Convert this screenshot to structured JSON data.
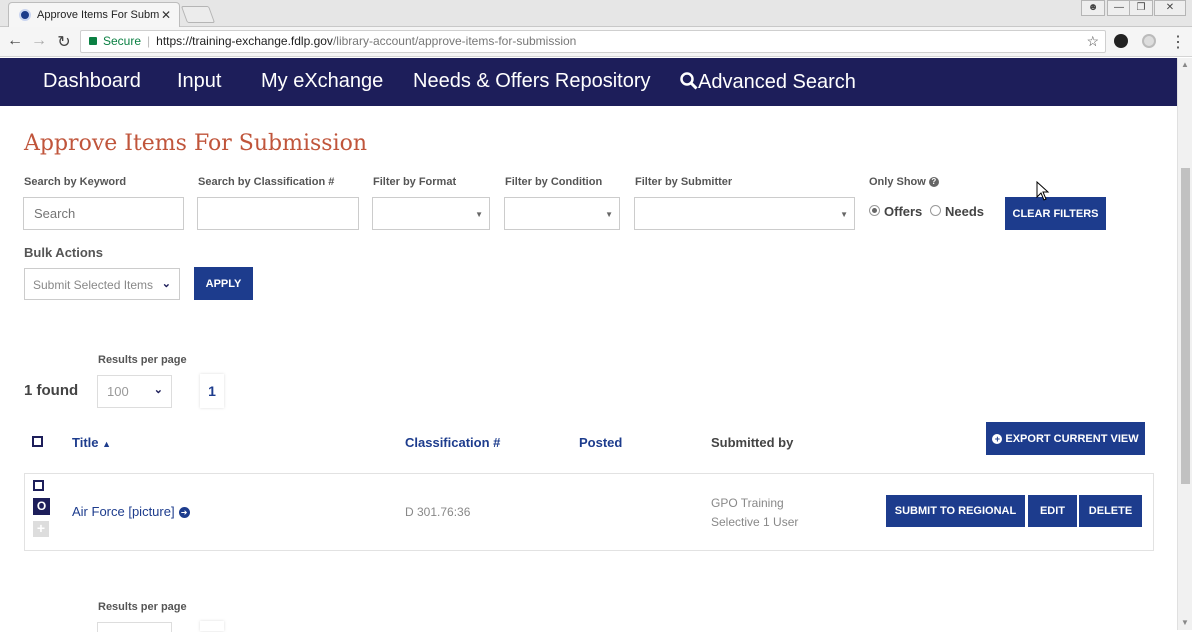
{
  "browser": {
    "tab_title": "Approve Items For Subm",
    "tab_close": "✕",
    "secure_label": "Secure",
    "url_host": "https://training-exchange.fdlp.gov",
    "url_path": "/library-account/approve-items-for-submission"
  },
  "nav": {
    "items": [
      "Dashboard",
      "Input",
      "My eXchange",
      "Needs & Offers Repository",
      "Advanced Search"
    ]
  },
  "page": {
    "title": "Approve Items For Submission"
  },
  "filters": {
    "keyword_label": "Search by Keyword",
    "keyword_placeholder": "Search",
    "classification_label": "Search by Classification #",
    "format_label": "Filter by Format",
    "condition_label": "Filter by Condition",
    "submitter_label": "Filter by Submitter",
    "only_show_label": "Only Show",
    "offers_label": "Offers",
    "needs_label": "Needs",
    "selected": "Offers",
    "clear_button": "CLEAR FILTERS"
  },
  "bulk": {
    "label": "Bulk Actions",
    "selected": "Submit Selected Items",
    "apply_button": "APPLY"
  },
  "results": {
    "per_page_label": "Results per page",
    "per_page_value": "100",
    "found_text": "1 found",
    "current_page": "1",
    "export_button": "EXPORT CURRENT VIEW",
    "columns": {
      "title": "Title",
      "classification": "Classification #",
      "posted": "Posted",
      "submitted_by": "Submitted by"
    },
    "rows": [
      {
        "badge": "O",
        "title": "Air Force [picture]",
        "classification": "D 301.76:36",
        "posted": "",
        "submitted_by_line1": "GPO Training",
        "submitted_by_line2": "Selective 1 User",
        "actions": {
          "submit": "SUBMIT TO REGIONAL",
          "edit": "EDIT",
          "delete": "DELETE"
        }
      }
    ],
    "bottom_per_page_label": "Results per page"
  }
}
